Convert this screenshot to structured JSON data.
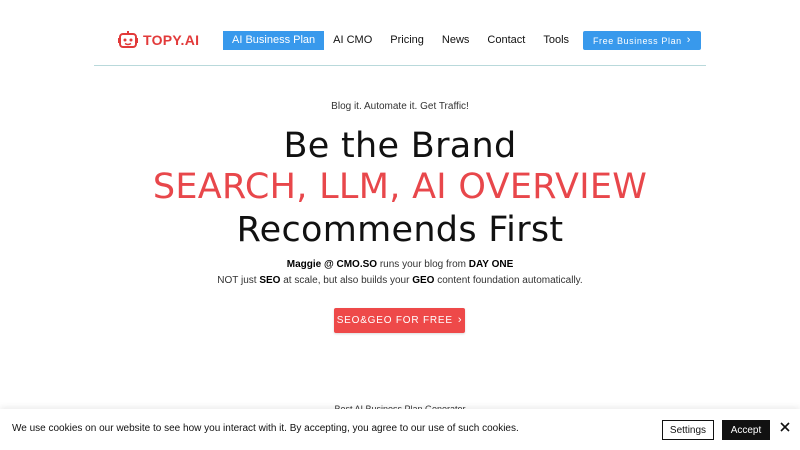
{
  "header": {
    "logo_text": "TOPY.AI",
    "logo_icon": "robot-face-icon",
    "nav": [
      {
        "label": "AI Business Plan",
        "active": true
      },
      {
        "label": "AI CMO",
        "active": false
      },
      {
        "label": "Pricing",
        "active": false
      },
      {
        "label": "News",
        "active": false
      },
      {
        "label": "Contact",
        "active": false
      },
      {
        "label": "Tools",
        "active": false
      }
    ],
    "cta_label": "Free Business Plan",
    "cta_icon": "chevron-right-icon"
  },
  "hero": {
    "eyebrow": "Blog it. Automate it. Get Traffic!",
    "line1": "Be the Brand",
    "line2": "SEARCH, LLM, AI OVERVIEW",
    "line3": "Recommends First",
    "sub1": {
      "b1": "Maggie @ CMO.SO",
      "t1": " runs your blog from ",
      "b2": "DAY ONE"
    },
    "sub2": {
      "t1": "NOT just ",
      "b1": "SEO",
      "t2": " at scale, but also builds your ",
      "b2": "GEO",
      "t3": " content foundation automatically."
    },
    "cta_label": "SEO&GEO FOR FREE",
    "cta_icon": "chevron-right-icon"
  },
  "next_section": {
    "label": "Best AI Business Plan Generator"
  },
  "cookie": {
    "text": "We use cookies on our website to see how you interact with it. By accepting, you agree to our use of such cookies.",
    "settings_label": "Settings",
    "accept_label": "Accept",
    "close_icon": "close-icon"
  },
  "colors": {
    "brand_red": "#e23a3a",
    "headline_red": "#e8474b",
    "cta_red": "#ee4949",
    "nav_blue": "#3899ec",
    "divider": "#b9d9db"
  }
}
